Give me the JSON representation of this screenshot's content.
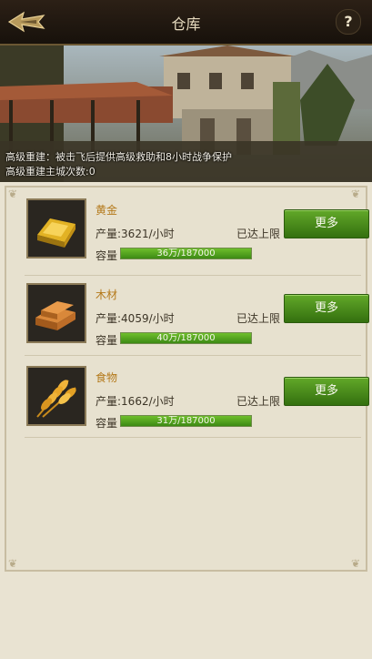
{
  "header": {
    "title": "仓库",
    "help_label": "?"
  },
  "banner": {
    "line1": "高级重建：被击飞后提供高级救助和8小时战争保护",
    "line2": "高级重建主城次数:0"
  },
  "resources": [
    {
      "name": "黄金",
      "production": "产量:3621/小时",
      "status": "已达上限",
      "capacity_label": "容量",
      "capacity_text": "36万/187000",
      "fill_fraction": 1.0,
      "more_label": "更多",
      "icon": "gold-bar-icon"
    },
    {
      "name": "木材",
      "production": "产量:4059/小时",
      "status": "已达上限",
      "capacity_label": "容量",
      "capacity_text": "40万/187000",
      "fill_fraction": 1.0,
      "more_label": "更多",
      "icon": "wood-icon"
    },
    {
      "name": "食物",
      "production": "产量:1662/小时",
      "status": "已达上限",
      "capacity_label": "容量",
      "capacity_text": "31万/187000",
      "fill_fraction": 1.0,
      "more_label": "更多",
      "icon": "wheat-icon"
    }
  ],
  "colors": {
    "accent_green": "#4a8f1c",
    "resource_name": "#b4791a"
  }
}
